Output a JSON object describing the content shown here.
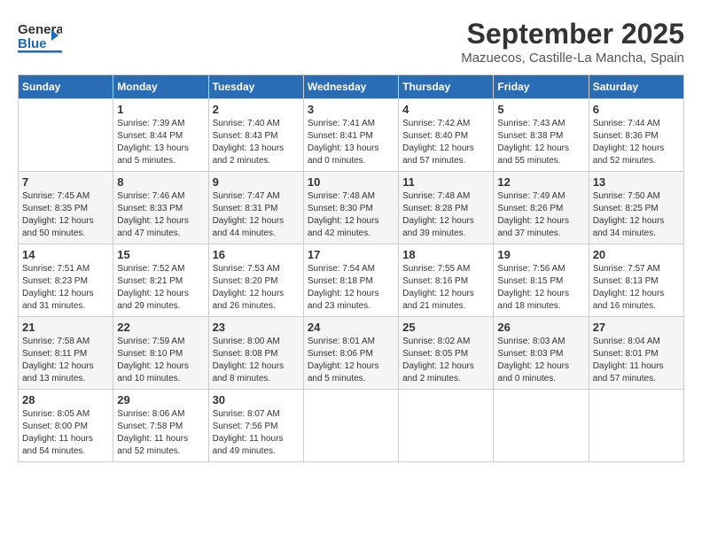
{
  "header": {
    "logo_general": "General",
    "logo_blue": "Blue",
    "month_year": "September 2025",
    "location": "Mazuecos, Castille-La Mancha, Spain"
  },
  "columns": [
    "Sunday",
    "Monday",
    "Tuesday",
    "Wednesday",
    "Thursday",
    "Friday",
    "Saturday"
  ],
  "weeks": [
    [
      {
        "day": "",
        "sunrise": "",
        "sunset": "",
        "daylight": ""
      },
      {
        "day": "1",
        "sunrise": "Sunrise: 7:39 AM",
        "sunset": "Sunset: 8:44 PM",
        "daylight": "Daylight: 13 hours and 5 minutes."
      },
      {
        "day": "2",
        "sunrise": "Sunrise: 7:40 AM",
        "sunset": "Sunset: 8:43 PM",
        "daylight": "Daylight: 13 hours and 2 minutes."
      },
      {
        "day": "3",
        "sunrise": "Sunrise: 7:41 AM",
        "sunset": "Sunset: 8:41 PM",
        "daylight": "Daylight: 13 hours and 0 minutes."
      },
      {
        "day": "4",
        "sunrise": "Sunrise: 7:42 AM",
        "sunset": "Sunset: 8:40 PM",
        "daylight": "Daylight: 12 hours and 57 minutes."
      },
      {
        "day": "5",
        "sunrise": "Sunrise: 7:43 AM",
        "sunset": "Sunset: 8:38 PM",
        "daylight": "Daylight: 12 hours and 55 minutes."
      },
      {
        "day": "6",
        "sunrise": "Sunrise: 7:44 AM",
        "sunset": "Sunset: 8:36 PM",
        "daylight": "Daylight: 12 hours and 52 minutes."
      }
    ],
    [
      {
        "day": "7",
        "sunrise": "Sunrise: 7:45 AM",
        "sunset": "Sunset: 8:35 PM",
        "daylight": "Daylight: 12 hours and 50 minutes."
      },
      {
        "day": "8",
        "sunrise": "Sunrise: 7:46 AM",
        "sunset": "Sunset: 8:33 PM",
        "daylight": "Daylight: 12 hours and 47 minutes."
      },
      {
        "day": "9",
        "sunrise": "Sunrise: 7:47 AM",
        "sunset": "Sunset: 8:31 PM",
        "daylight": "Daylight: 12 hours and 44 minutes."
      },
      {
        "day": "10",
        "sunrise": "Sunrise: 7:48 AM",
        "sunset": "Sunset: 8:30 PM",
        "daylight": "Daylight: 12 hours and 42 minutes."
      },
      {
        "day": "11",
        "sunrise": "Sunrise: 7:48 AM",
        "sunset": "Sunset: 8:28 PM",
        "daylight": "Daylight: 12 hours and 39 minutes."
      },
      {
        "day": "12",
        "sunrise": "Sunrise: 7:49 AM",
        "sunset": "Sunset: 8:26 PM",
        "daylight": "Daylight: 12 hours and 37 minutes."
      },
      {
        "day": "13",
        "sunrise": "Sunrise: 7:50 AM",
        "sunset": "Sunset: 8:25 PM",
        "daylight": "Daylight: 12 hours and 34 minutes."
      }
    ],
    [
      {
        "day": "14",
        "sunrise": "Sunrise: 7:51 AM",
        "sunset": "Sunset: 8:23 PM",
        "daylight": "Daylight: 12 hours and 31 minutes."
      },
      {
        "day": "15",
        "sunrise": "Sunrise: 7:52 AM",
        "sunset": "Sunset: 8:21 PM",
        "daylight": "Daylight: 12 hours and 29 minutes."
      },
      {
        "day": "16",
        "sunrise": "Sunrise: 7:53 AM",
        "sunset": "Sunset: 8:20 PM",
        "daylight": "Daylight: 12 hours and 26 minutes."
      },
      {
        "day": "17",
        "sunrise": "Sunrise: 7:54 AM",
        "sunset": "Sunset: 8:18 PM",
        "daylight": "Daylight: 12 hours and 23 minutes."
      },
      {
        "day": "18",
        "sunrise": "Sunrise: 7:55 AM",
        "sunset": "Sunset: 8:16 PM",
        "daylight": "Daylight: 12 hours and 21 minutes."
      },
      {
        "day": "19",
        "sunrise": "Sunrise: 7:56 AM",
        "sunset": "Sunset: 8:15 PM",
        "daylight": "Daylight: 12 hours and 18 minutes."
      },
      {
        "day": "20",
        "sunrise": "Sunrise: 7:57 AM",
        "sunset": "Sunset: 8:13 PM",
        "daylight": "Daylight: 12 hours and 16 minutes."
      }
    ],
    [
      {
        "day": "21",
        "sunrise": "Sunrise: 7:58 AM",
        "sunset": "Sunset: 8:11 PM",
        "daylight": "Daylight: 12 hours and 13 minutes."
      },
      {
        "day": "22",
        "sunrise": "Sunrise: 7:59 AM",
        "sunset": "Sunset: 8:10 PM",
        "daylight": "Daylight: 12 hours and 10 minutes."
      },
      {
        "day": "23",
        "sunrise": "Sunrise: 8:00 AM",
        "sunset": "Sunset: 8:08 PM",
        "daylight": "Daylight: 12 hours and 8 minutes."
      },
      {
        "day": "24",
        "sunrise": "Sunrise: 8:01 AM",
        "sunset": "Sunset: 8:06 PM",
        "daylight": "Daylight: 12 hours and 5 minutes."
      },
      {
        "day": "25",
        "sunrise": "Sunrise: 8:02 AM",
        "sunset": "Sunset: 8:05 PM",
        "daylight": "Daylight: 12 hours and 2 minutes."
      },
      {
        "day": "26",
        "sunrise": "Sunrise: 8:03 AM",
        "sunset": "Sunset: 8:03 PM",
        "daylight": "Daylight: 12 hours and 0 minutes."
      },
      {
        "day": "27",
        "sunrise": "Sunrise: 8:04 AM",
        "sunset": "Sunset: 8:01 PM",
        "daylight": "Daylight: 11 hours and 57 minutes."
      }
    ],
    [
      {
        "day": "28",
        "sunrise": "Sunrise: 8:05 AM",
        "sunset": "Sunset: 8:00 PM",
        "daylight": "Daylight: 11 hours and 54 minutes."
      },
      {
        "day": "29",
        "sunrise": "Sunrise: 8:06 AM",
        "sunset": "Sunset: 7:58 PM",
        "daylight": "Daylight: 11 hours and 52 minutes."
      },
      {
        "day": "30",
        "sunrise": "Sunrise: 8:07 AM",
        "sunset": "Sunset: 7:56 PM",
        "daylight": "Daylight: 11 hours and 49 minutes."
      },
      {
        "day": "",
        "sunrise": "",
        "sunset": "",
        "daylight": ""
      },
      {
        "day": "",
        "sunrise": "",
        "sunset": "",
        "daylight": ""
      },
      {
        "day": "",
        "sunrise": "",
        "sunset": "",
        "daylight": ""
      },
      {
        "day": "",
        "sunrise": "",
        "sunset": "",
        "daylight": ""
      }
    ]
  ]
}
